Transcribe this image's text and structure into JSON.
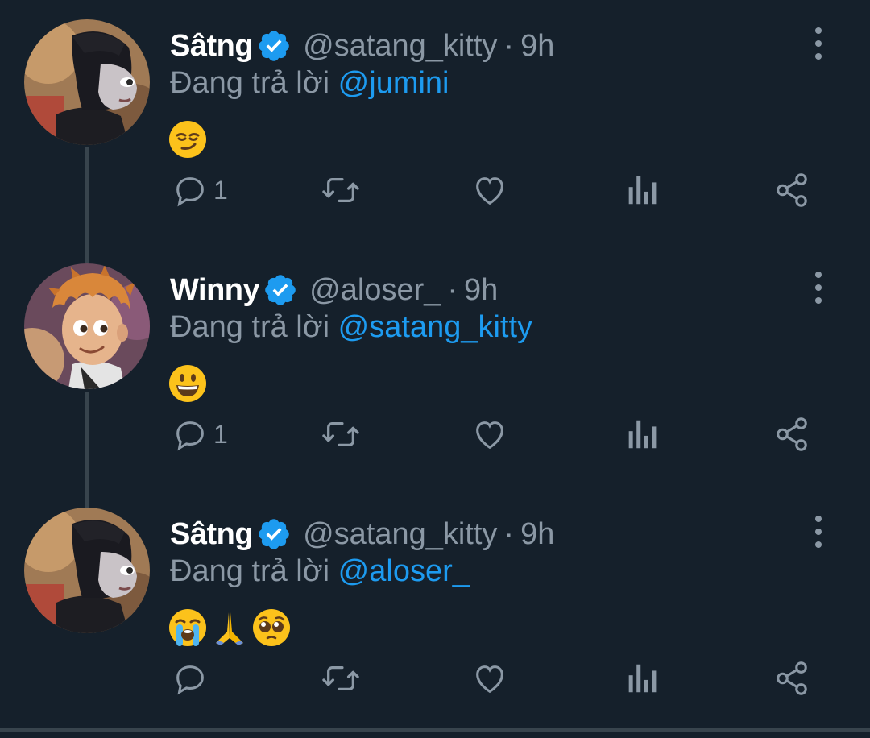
{
  "tweets": [
    {
      "name": "Sâtng",
      "handle": "@satang_kitty",
      "separator": "·",
      "time": "9h",
      "reply_prefix": "Đang trả lời",
      "reply_to": "@jumini",
      "emojis": [
        "smirking-face"
      ],
      "reply_count": "1",
      "avatar": "avatar-girl"
    },
    {
      "name": "Winny",
      "handle": "@aloser_",
      "separator": "·",
      "time": "9h",
      "reply_prefix": "Đang trả lời",
      "reply_to": "@satang_kitty",
      "emojis": [
        "grinning-face"
      ],
      "reply_count": "1",
      "avatar": "avatar-boy"
    },
    {
      "name": "Sâtng",
      "handle": "@satang_kitty",
      "separator": "·",
      "time": "9h",
      "reply_prefix": "Đang trả lời",
      "reply_to": "@aloser_",
      "emojis": [
        "loudly-crying-face",
        "folded-hands",
        "pleading-face"
      ],
      "reply_count": "",
      "avatar": "avatar-girl"
    }
  ],
  "colors": {
    "background": "#15202b",
    "muted": "#8b98a5",
    "link": "#1d9bf0",
    "verified": "#1d9bf0",
    "thread_line": "#38444d"
  },
  "icons": {
    "reply": "reply-icon",
    "retweet": "retweet-icon",
    "like": "heart-icon",
    "views": "analytics-icon",
    "share": "share-icon",
    "more": "more-vertical-icon",
    "verified": "verified-badge-icon"
  }
}
